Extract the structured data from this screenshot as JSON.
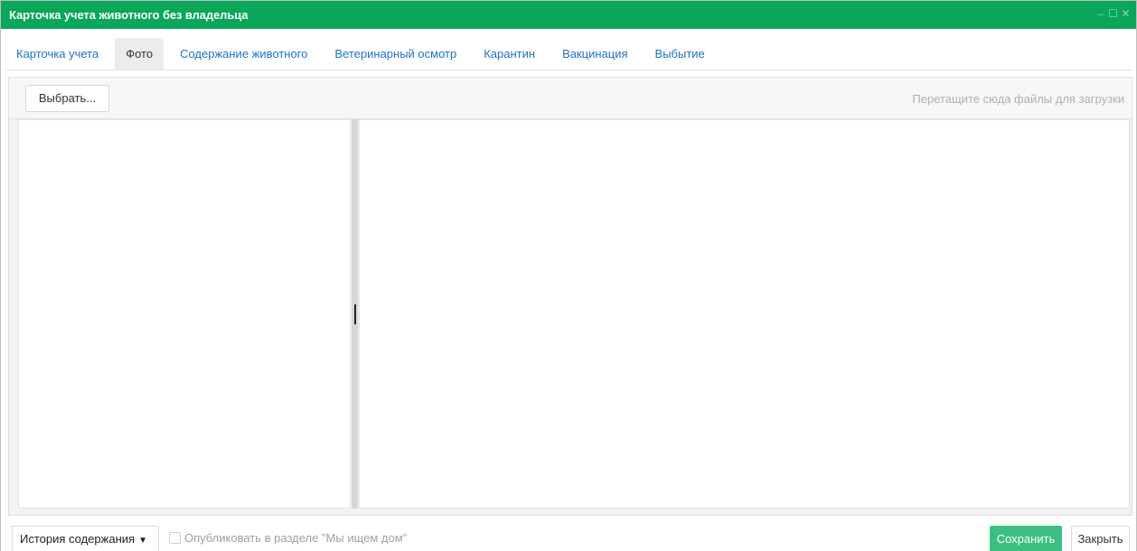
{
  "window": {
    "title": "Карточка учета животного без владельца",
    "controls": {
      "minimize": "–",
      "maximize": "☐",
      "close": "✕"
    },
    "accent_color": "#0aa65a"
  },
  "tabs": [
    {
      "label": "Карточка учета",
      "active": false
    },
    {
      "label": "Фото",
      "active": true
    },
    {
      "label": "Содержание животного",
      "active": false
    },
    {
      "label": "Ветеринарный осмотр",
      "active": false
    },
    {
      "label": "Карантин",
      "active": false
    },
    {
      "label": "Вакцинация",
      "active": false
    },
    {
      "label": "Выбытие",
      "active": false
    }
  ],
  "upload": {
    "choose_label": "Выбрать...",
    "drop_hint": "Перетащите сюда файлы для загрузки"
  },
  "footer": {
    "history_label": "История содержания",
    "history_caret": "▼",
    "publish_label": "Опубликовать в разделе \"Мы ищем дом\"",
    "publish_checked": false,
    "save_label": "Сохранить",
    "close_label": "Закрыть",
    "save_color": "#3cbf80"
  }
}
